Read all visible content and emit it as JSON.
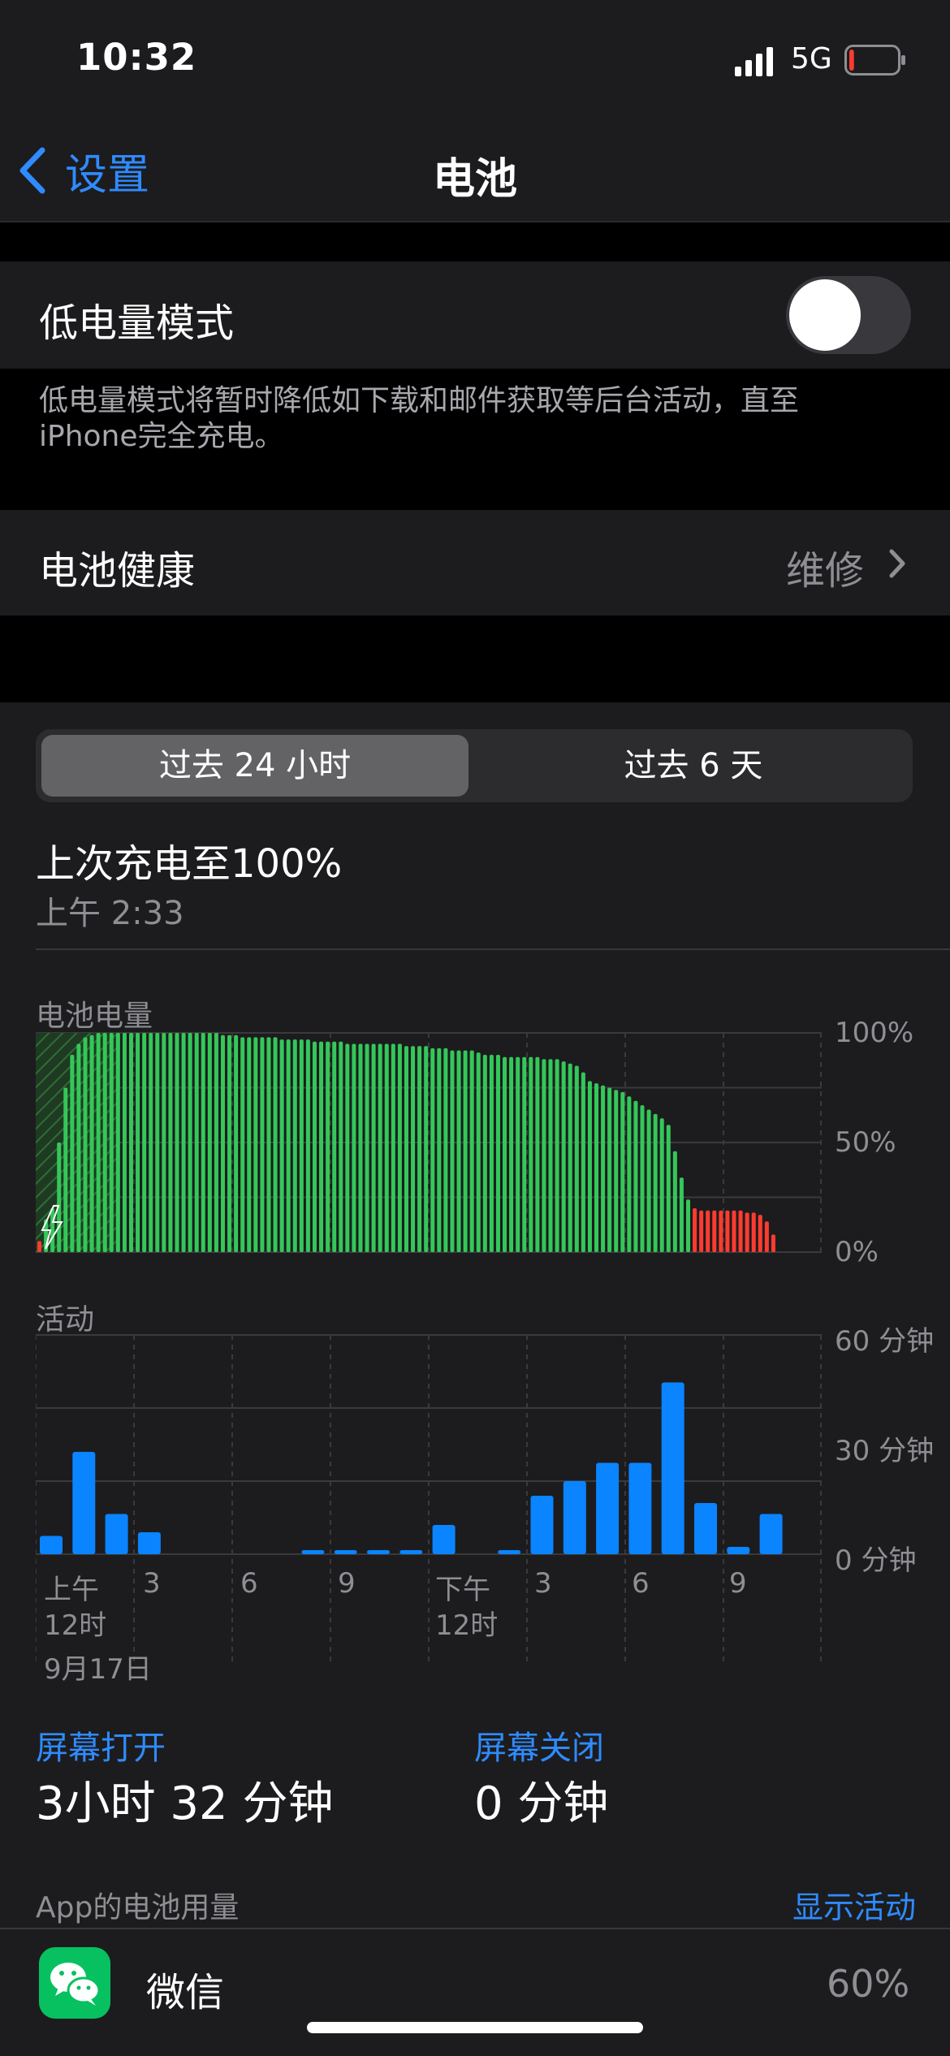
{
  "status_bar": {
    "time": "10:32",
    "network": "5G",
    "battery_level": 0.1
  },
  "nav": {
    "back_label": "设置",
    "title": "电池"
  },
  "low_power": {
    "label": "低电量模式",
    "enabled": false,
    "footer": [
      "低电量模式将暂时降低如下载和邮件获取等后台活动，直至",
      "iPhone完全充电。"
    ]
  },
  "battery_health": {
    "label": "电池健康",
    "value": "维修"
  },
  "segments": {
    "tabs": [
      "过去 24 小时",
      "过去 6 天"
    ],
    "selected": 0
  },
  "last_charge": {
    "title": "上次充电至100%",
    "time": "上午 2:33"
  },
  "colors": {
    "green": "#34c759",
    "red": "#ff3b30",
    "blue": "#0a84ff",
    "accent": "#2f8bff"
  },
  "battery_chart_label": "电池电量",
  "activity_chart_label": "活动",
  "x_axis": {
    "ticks": [
      "上午",
      "12时",
      "3",
      "6",
      "9",
      "下午",
      "12时",
      "3",
      "6",
      "9"
    ],
    "date": "9月17日"
  },
  "chart_data": [
    {
      "type": "bar",
      "title": "电池电量",
      "ylim": [
        0,
        100
      ],
      "yticks": [
        "100%",
        "50%",
        "0%"
      ],
      "values": [
        5,
        15,
        20,
        50,
        75,
        90,
        95,
        98,
        99,
        100,
        100,
        100,
        100,
        100,
        100,
        100,
        100,
        100,
        100,
        100,
        100,
        100,
        100,
        100,
        100,
        100,
        100,
        100,
        99,
        99,
        99,
        98,
        98,
        98,
        98,
        98,
        98,
        97,
        97,
        97,
        97,
        97,
        96,
        96,
        96,
        96,
        96,
        95,
        95,
        95,
        95,
        95,
        95,
        95,
        95,
        95,
        94,
        94,
        94,
        94,
        93,
        93,
        93,
        92,
        92,
        92,
        92,
        91,
        90,
        90,
        90,
        89,
        89,
        89,
        89,
        89,
        89,
        88,
        88,
        88,
        87,
        86,
        85,
        82,
        78,
        77,
        76,
        75,
        74,
        73,
        71,
        69,
        67,
        65,
        63,
        61,
        58,
        46,
        34,
        24,
        20,
        19,
        19,
        19,
        19,
        19,
        19,
        19,
        18,
        18,
        17,
        14,
        8
      ],
      "low_threshold": 20,
      "charging": true
    },
    {
      "type": "bar",
      "title": "活动",
      "ylim": [
        0,
        60
      ],
      "yticks": [
        "60 分钟",
        "30 分钟",
        "0 分钟"
      ],
      "values": [
        5,
        28,
        11,
        6,
        0,
        0,
        0,
        0,
        1,
        1,
        1,
        1,
        8,
        0,
        1,
        16,
        20,
        25,
        25,
        47,
        14,
        2,
        11
      ]
    }
  ],
  "screen_on": {
    "label": "屏幕打开",
    "value": "3小时 32 分钟"
  },
  "screen_off": {
    "label": "屏幕关闭",
    "value": "0 分钟"
  },
  "app_usage": {
    "header": "App的电池用量",
    "show_activity": "显示活动",
    "apps": [
      {
        "name": "微信",
        "percent": "60%",
        "icon": "wechat-icon"
      }
    ]
  }
}
